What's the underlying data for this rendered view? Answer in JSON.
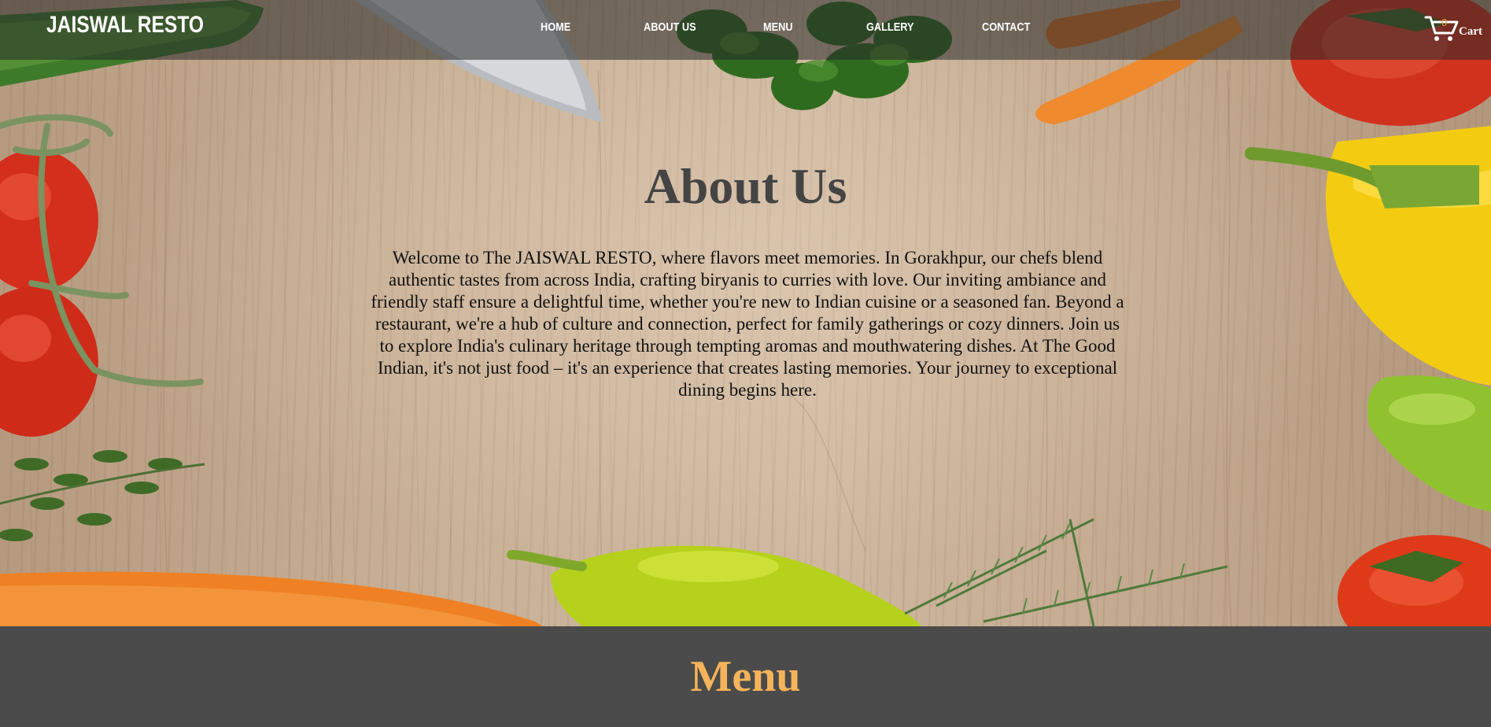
{
  "brand": "JAISWAL RESTO",
  "nav": {
    "items": [
      {
        "label": "HOME"
      },
      {
        "label": "ABOUT US"
      },
      {
        "label": "MENU"
      },
      {
        "label": "GALLERY"
      },
      {
        "label": "CONTACT"
      }
    ]
  },
  "cart": {
    "count": "0",
    "label": "Cart"
  },
  "about": {
    "title": "About Us",
    "text": "Welcome to The JAISWAL RESTO, where flavors meet memories. In Gorakhpur, our chefs blend authentic tastes from across India, crafting biryanis to curries with love. Our inviting ambiance and friendly staff ensure a delightful time, whether you're new to Indian cuisine or a seasoned fan. Beyond a restaurant, we're a hub of culture and connection, perfect for family gatherings or cozy dinners. Join us to explore India's culinary heritage through tempting aromas and mouthwatering dishes. At The Good Indian, it's not just food – it's an experience that creates lasting memories. Your journey to exceptional dining begins here."
  },
  "menu_section": {
    "title": "Menu"
  },
  "colors": {
    "navbar": "#282828",
    "menu_bg": "#4b4b4b",
    "menu_title": "#f5b45a",
    "cart_count": "#f0a030"
  }
}
